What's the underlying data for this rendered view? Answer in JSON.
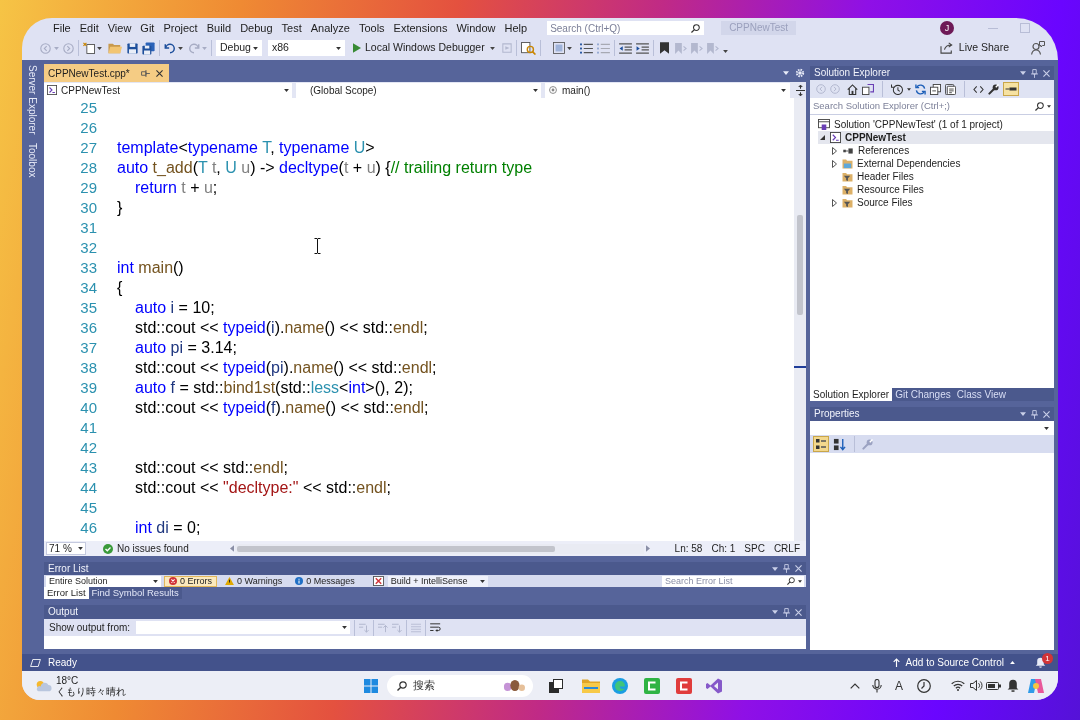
{
  "menu_bar": {
    "items": [
      "File",
      "Edit",
      "View",
      "Git",
      "Project",
      "Build",
      "Debug",
      "Test",
      "Analyze",
      "Tools",
      "Extensions",
      "Window",
      "Help"
    ],
    "search": {
      "placeholder": "Search (Ctrl+Q)"
    },
    "solution_name": "CPPNewTest",
    "account_initial": "J"
  },
  "toolbar": {
    "configuration": "Debug",
    "platform": "x86",
    "run_button": "Local Windows Debugger",
    "live_share": "Live Share"
  },
  "side_tabs": [
    "Server Explorer",
    "Toolbox"
  ],
  "editor": {
    "tabs": [
      {
        "label": "CPPNewTest.cpp*",
        "selected": true
      }
    ],
    "navigation": {
      "project": "CPPNewTest",
      "scope": "(Global Scope)",
      "member": "main()"
    },
    "lines": [
      {
        "number": "25"
      },
      {
        "number": "26"
      },
      {
        "number": "27",
        "tokens": [
          {
            "kind": "keyword",
            "text": "template"
          },
          {
            "kind": "plain",
            "text": "<"
          },
          {
            "kind": "keyword",
            "text": "typename"
          },
          {
            "kind": "type",
            "text": " T"
          },
          {
            "kind": "plain",
            "text": ", "
          },
          {
            "kind": "keyword",
            "text": "typename"
          },
          {
            "kind": "type",
            "text": " U"
          },
          {
            "kind": "plain",
            "text": ">"
          }
        ]
      },
      {
        "number": "28",
        "tokens": [
          {
            "kind": "keyword",
            "text": "auto"
          },
          {
            "kind": "function",
            "text": " t_add"
          },
          {
            "kind": "plain",
            "text": "("
          },
          {
            "kind": "type",
            "text": "T"
          },
          {
            "kind": "param",
            "text": " t"
          },
          {
            "kind": "plain",
            "text": ", "
          },
          {
            "kind": "type",
            "text": "U"
          },
          {
            "kind": "param",
            "text": " u"
          },
          {
            "kind": "plain",
            "text": ") -> "
          },
          {
            "kind": "keyword",
            "text": "decltype"
          },
          {
            "kind": "plain",
            "text": "("
          },
          {
            "kind": "param",
            "text": "t"
          },
          {
            "kind": "plain",
            "text": " + "
          },
          {
            "kind": "param",
            "text": "u"
          },
          {
            "kind": "plain",
            "text": ") {"
          },
          {
            "kind": "comment",
            "text": "// trailing return type"
          }
        ],
        "children": [
          {
            "number": "29",
            "tokens": [
              {
                "kind": "keyword",
                "text": "return"
              },
              {
                "kind": "param",
                "text": " t"
              },
              {
                "kind": "plain",
                "text": " + "
              },
              {
                "kind": "param",
                "text": "u"
              },
              {
                "kind": "plain",
                "text": ";"
              }
            ]
          }
        ]
      },
      {
        "number": "30",
        "tokens": [
          {
            "kind": "plain",
            "text": "}"
          }
        ]
      },
      {
        "number": "31"
      },
      {
        "number": "32"
      },
      {
        "number": "33",
        "tokens": [
          {
            "kind": "keyword",
            "text": "int"
          },
          {
            "kind": "function",
            "text": " main"
          },
          {
            "kind": "plain",
            "text": "()"
          }
        ]
      },
      {
        "number": "34",
        "tokens": [
          {
            "kind": "plain",
            "text": "{"
          }
        ],
        "children": [
          {
            "number": "35",
            "tokens": [
              {
                "kind": "keyword",
                "text": "auto"
              },
              {
                "kind": "local",
                "text": " i"
              },
              {
                "kind": "plain",
                "text": " = 10;"
              }
            ]
          },
          {
            "number": "36",
            "tokens": [
              {
                "kind": "plain",
                "text": "std::cout << "
              },
              {
                "kind": "keyword",
                "text": "typeid"
              },
              {
                "kind": "plain",
                "text": "("
              },
              {
                "kind": "local",
                "text": "i"
              },
              {
                "kind": "plain",
                "text": ")."
              },
              {
                "kind": "function",
                "text": "name"
              },
              {
                "kind": "plain",
                "text": "() << std::"
              },
              {
                "kind": "function",
                "text": "endl"
              },
              {
                "kind": "plain",
                "text": ";"
              }
            ]
          },
          {
            "number": "37",
            "tokens": [
              {
                "kind": "keyword",
                "text": "auto"
              },
              {
                "kind": "local",
                "text": " pi"
              },
              {
                "kind": "plain",
                "text": " = 3.14;"
              }
            ]
          },
          {
            "number": "38",
            "tokens": [
              {
                "kind": "plain",
                "text": "std::cout << "
              },
              {
                "kind": "keyword",
                "text": "typeid"
              },
              {
                "kind": "plain",
                "text": "("
              },
              {
                "kind": "local",
                "text": "pi"
              },
              {
                "kind": "plain",
                "text": ")."
              },
              {
                "kind": "function",
                "text": "name"
              },
              {
                "kind": "plain",
                "text": "() << std::"
              },
              {
                "kind": "function",
                "text": "endl"
              },
              {
                "kind": "plain",
                "text": ";"
              }
            ]
          },
          {
            "number": "39",
            "tokens": [
              {
                "kind": "keyword",
                "text": "auto"
              },
              {
                "kind": "local",
                "text": " f"
              },
              {
                "kind": "plain",
                "text": " = std::"
              },
              {
                "kind": "function",
                "text": "bind1st"
              },
              {
                "kind": "plain",
                "text": "(std::"
              },
              {
                "kind": "type",
                "text": "less"
              },
              {
                "kind": "plain",
                "text": "<"
              },
              {
                "kind": "keyword",
                "text": "int"
              },
              {
                "kind": "plain",
                "text": ">(), 2);"
              }
            ]
          },
          {
            "number": "40",
            "tokens": [
              {
                "kind": "plain",
                "text": "std::cout << "
              },
              {
                "kind": "keyword",
                "text": "typeid"
              },
              {
                "kind": "plain",
                "text": "("
              },
              {
                "kind": "local",
                "text": "f"
              },
              {
                "kind": "plain",
                "text": ")."
              },
              {
                "kind": "function",
                "text": "name"
              },
              {
                "kind": "plain",
                "text": "() << std::"
              },
              {
                "kind": "function",
                "text": "endl"
              },
              {
                "kind": "plain",
                "text": ";"
              }
            ]
          },
          {
            "number": "41"
          },
          {
            "number": "42"
          },
          {
            "number": "43",
            "tokens": [
              {
                "kind": "plain",
                "text": "std::cout << std::"
              },
              {
                "kind": "function",
                "text": "endl"
              },
              {
                "kind": "plain",
                "text": ";"
              }
            ]
          },
          {
            "number": "44",
            "tokens": [
              {
                "kind": "plain",
                "text": "std::cout << "
              },
              {
                "kind": "string",
                "text": "\"decltype:\""
              },
              {
                "kind": "plain",
                "text": " << std::"
              },
              {
                "kind": "function",
                "text": "endl"
              },
              {
                "kind": "plain",
                "text": ";"
              }
            ]
          },
          {
            "number": "45"
          },
          {
            "number": "46",
            "tokens": [
              {
                "kind": "keyword",
                "text": "int"
              },
              {
                "kind": "local",
                "text": " di"
              },
              {
                "kind": "plain",
                "text": " = 0;"
              }
            ]
          }
        ]
      }
    ],
    "status": {
      "zoom": "71 %",
      "issues": "No issues found",
      "line": "Ln: 58",
      "column": "Ch: 1",
      "whitespace": "SPC",
      "line_ending": "CRLF"
    }
  },
  "error_list": {
    "title": "Error List",
    "scope": "Entire Solution",
    "filters": [
      {
        "kind": "error",
        "label": "0 Errors",
        "selected": true
      },
      {
        "kind": "warning",
        "label": "0 Warnings",
        "selected": false
      },
      {
        "kind": "message",
        "label": "0 Messages",
        "selected": false
      }
    ],
    "source": "Build + IntelliSense",
    "search": {
      "placeholder": "Search Error List"
    },
    "tabs": [
      {
        "label": "Error List",
        "selected": true
      },
      {
        "label": "Find Symbol Results",
        "selected": false
      }
    ]
  },
  "output": {
    "title": "Output",
    "source_label": "Show output from:"
  },
  "solution_explorer": {
    "title": "Solution Explorer",
    "preview_selected_items": true,
    "search": {
      "placeholder": "Search Solution Explorer (Ctrl+;)"
    },
    "tree": [
      {
        "label": "Solution 'CPPNewTest' (1 of 1 project)",
        "kind": "solution",
        "selected": false,
        "children": [
          {
            "label": "CPPNewTest",
            "kind": "project",
            "selected": true,
            "expanded": true,
            "children": [
              {
                "label": "References",
                "kind": "references",
                "selected": false,
                "expanded": false
              },
              {
                "label": "External Dependencies",
                "kind": "dependencies",
                "selected": false,
                "expanded": false
              },
              {
                "label": "Header Files",
                "kind": "filter",
                "selected": false
              },
              {
                "label": "Resource Files",
                "kind": "filter",
                "selected": false
              },
              {
                "label": "Source Files",
                "kind": "filter",
                "selected": false,
                "expanded": false
              }
            ]
          }
        ]
      }
    ],
    "tabs": [
      {
        "label": "Solution Explorer",
        "selected": true
      },
      {
        "label": "Git Changes",
        "selected": false
      },
      {
        "label": "Class View",
        "selected": false
      }
    ]
  },
  "properties": {
    "title": "Properties",
    "view_buttons": [
      {
        "kind": "categorized",
        "selected": true
      },
      {
        "kind": "alphabetical",
        "selected": false
      }
    ]
  },
  "status_bar": {
    "text": "Ready",
    "source_control": "Add to Source Control",
    "notification_count": "1"
  },
  "taskbar": {
    "weather": {
      "temperature": "18°C",
      "condition": "くもり時々晴れ"
    },
    "search": {
      "placeholder": "搜索"
    },
    "input_mode": "A"
  }
}
